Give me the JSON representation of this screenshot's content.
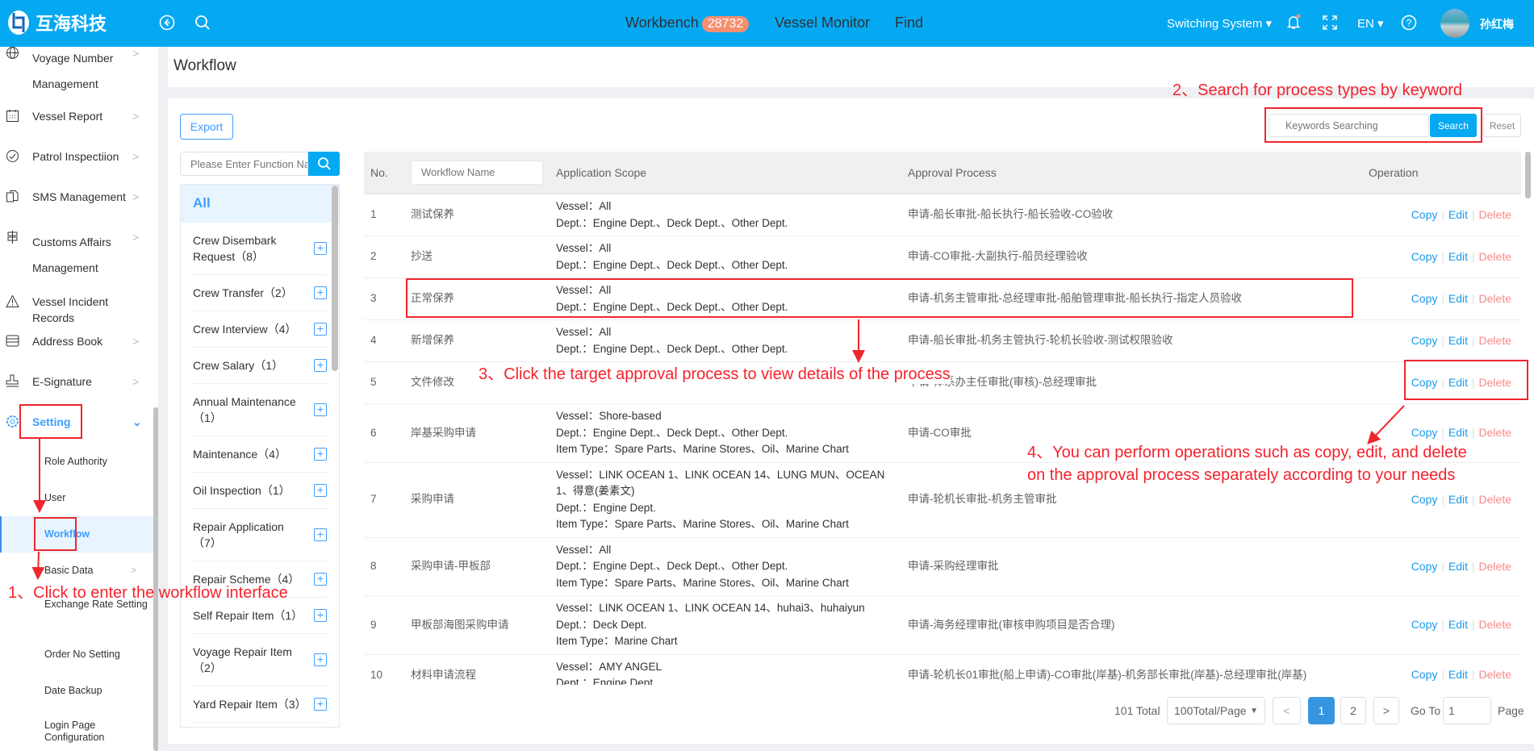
{
  "header": {
    "brand": "互海科技",
    "nav": [
      {
        "label": "Workbench",
        "badge": "28732"
      },
      {
        "label": "Vessel Monitor"
      },
      {
        "label": "Find"
      }
    ],
    "switching_system": "Switching System",
    "language": "EN",
    "user_name": "孙红梅",
    "icons": [
      "back-circle-icon",
      "search-icon",
      "bell-icon",
      "fullscreen-icon",
      "help-icon"
    ]
  },
  "sidebar": {
    "items": [
      {
        "label": "Voyage Number Management",
        "icon": "globe-icon"
      },
      {
        "label": "Vessel Report",
        "icon": "calendar-icon"
      },
      {
        "label": "Patrol Inspectiion",
        "icon": "check-circle-icon"
      },
      {
        "label": "SMS Management",
        "icon": "documents-icon"
      },
      {
        "label": "Customs Affairs Management",
        "icon": "signpost-icon"
      },
      {
        "label": "Vessel Incident Records",
        "icon": "warning-icon"
      },
      {
        "label": "Address Book",
        "icon": "address-book-icon"
      },
      {
        "label": "E-Signature",
        "icon": "stamp-icon"
      },
      {
        "label": "Setting",
        "icon": "gear-icon"
      }
    ],
    "setting_children": [
      "Role Authority",
      "User",
      "Workflow",
      "Basic Data",
      "Exchange Rate Setting",
      "Order No Setting",
      "Date Backup",
      "Login Page Configuration"
    ],
    "active": "Workflow"
  },
  "page": {
    "title": "Workflow",
    "export_label": "Export",
    "category_search_placeholder": "Please Enter Function Name",
    "keyword_placeholder": "Keywords Searching",
    "search_label": "Search",
    "reset_label": "Reset"
  },
  "categories": {
    "all_label": "All",
    "items": [
      "Crew Disembark Request（8）",
      "Crew Transfer（2）",
      "Crew Interview（4）",
      "Crew Salary（1）",
      "Annual Maintenance（1）",
      "Maintenance（4）",
      "Oil Inspection（1）",
      "Repair Application（7）",
      "Repair Scheme（4）",
      "Self Repair Item（1）",
      "Voyage Repair Item（2）",
      "Yard Repair Item（3）"
    ]
  },
  "table": {
    "columns": {
      "no": "No.",
      "name_placeholder": "Workflow Name",
      "scope": "Application Scope",
      "approval": "Approval Process",
      "operation": "Operation"
    },
    "ops": {
      "copy": "Copy",
      "edit": "Edit",
      "delete": "Delete"
    },
    "rows": [
      {
        "no": "1",
        "name": "测试保养",
        "scope": [
          "Vessel：All",
          "Dept.：Engine Dept.、Deck Dept.、Other Dept."
        ],
        "approval": "申请-船长审批-船长执行-船长验收-CO验收"
      },
      {
        "no": "2",
        "name": "抄送",
        "scope": [
          "Vessel：All",
          "Dept.：Engine Dept.、Deck Dept.、Other Dept."
        ],
        "approval": "申请-CO审批-大副执行-船员经理验收"
      },
      {
        "no": "3",
        "name": "正常保养",
        "scope": [
          "Vessel：All",
          "Dept.：Engine Dept.、Deck Dept.、Other Dept."
        ],
        "approval": "申请-机务主管审批-总经理审批-船舶管理审批-船长执行-指定人员验收"
      },
      {
        "no": "4",
        "name": "新增保养",
        "scope": [
          "Vessel：All",
          "Dept.：Engine Dept.、Deck Dept.、Other Dept."
        ],
        "approval": "申请-船长审批-机务主管执行-轮机长验收-测试权限验收"
      },
      {
        "no": "5",
        "name": "文件修改",
        "scope": [
          "",
          ""
        ],
        "approval": "申请-体系办主任审批(审核)-总经理审批"
      },
      {
        "no": "6",
        "name": "岸基采购申请",
        "scope": [
          "Vessel：Shore-based",
          "Dept.：Engine Dept.、Deck Dept.、Other Dept.",
          "Item Type：Spare Parts、Marine Stores、Oil、Marine Chart"
        ],
        "approval": "申请-CO审批"
      },
      {
        "no": "7",
        "name": "采购申请",
        "scope": [
          "Vessel：LINK OCEAN 1、LINK OCEAN 14、LUNG MUN、OCEAN 1、得意(姜素文)",
          "Dept.：Engine Dept.",
          "Item Type：Spare Parts、Marine Stores、Oil、Marine Chart"
        ],
        "approval": "申请-轮机长审批-机务主管审批"
      },
      {
        "no": "8",
        "name": "采购申请-甲板部",
        "scope": [
          "Vessel：All",
          "Dept.：Engine Dept.、Deck Dept.、Other Dept.",
          "Item Type：Spare Parts、Marine Stores、Oil、Marine Chart"
        ],
        "approval": "申请-采购经理审批"
      },
      {
        "no": "9",
        "name": "甲板部海图采购申请",
        "scope": [
          "Vessel：LINK OCEAN 1、LINK OCEAN 14、huhai3、huhaiyun",
          "Dept.：Deck Dept.",
          "Item Type：Marine Chart"
        ],
        "approval": "申请-海务经理审批(审核申购项目是否合理)"
      },
      {
        "no": "10",
        "name": "材料申请流程",
        "scope": [
          "Vessel：AMY ANGEL",
          "Dept.：Engine Dept."
        ],
        "approval": "申请-轮机长01审批(船上申请)-CO审批(岸基)-机务部长审批(岸基)-总经理审批(岸基)"
      }
    ]
  },
  "pagination": {
    "total": "101 Total",
    "page_size": "100Total/Page",
    "prev": "<",
    "pages": [
      "1",
      "2"
    ],
    "current": "1",
    "next": ">",
    "goto_label": "Go To",
    "goto_value": "1",
    "page_suffix": "Page"
  },
  "annotations": {
    "step1": "1、Click to enter the workflow interface",
    "step2": "2、Search for process types by keyword",
    "step3": "3、Click the target approval process to view details of the process",
    "step4_line1": "4、You can perform operations such as copy, edit, and delete",
    "step4_line2": "on the approval process separately according to your needs",
    "color": "#f5222d"
  },
  "colors": {
    "header": "#05a9f2",
    "primary": "#409eff",
    "delete": "#f78989",
    "badge": "#f78e6f"
  }
}
